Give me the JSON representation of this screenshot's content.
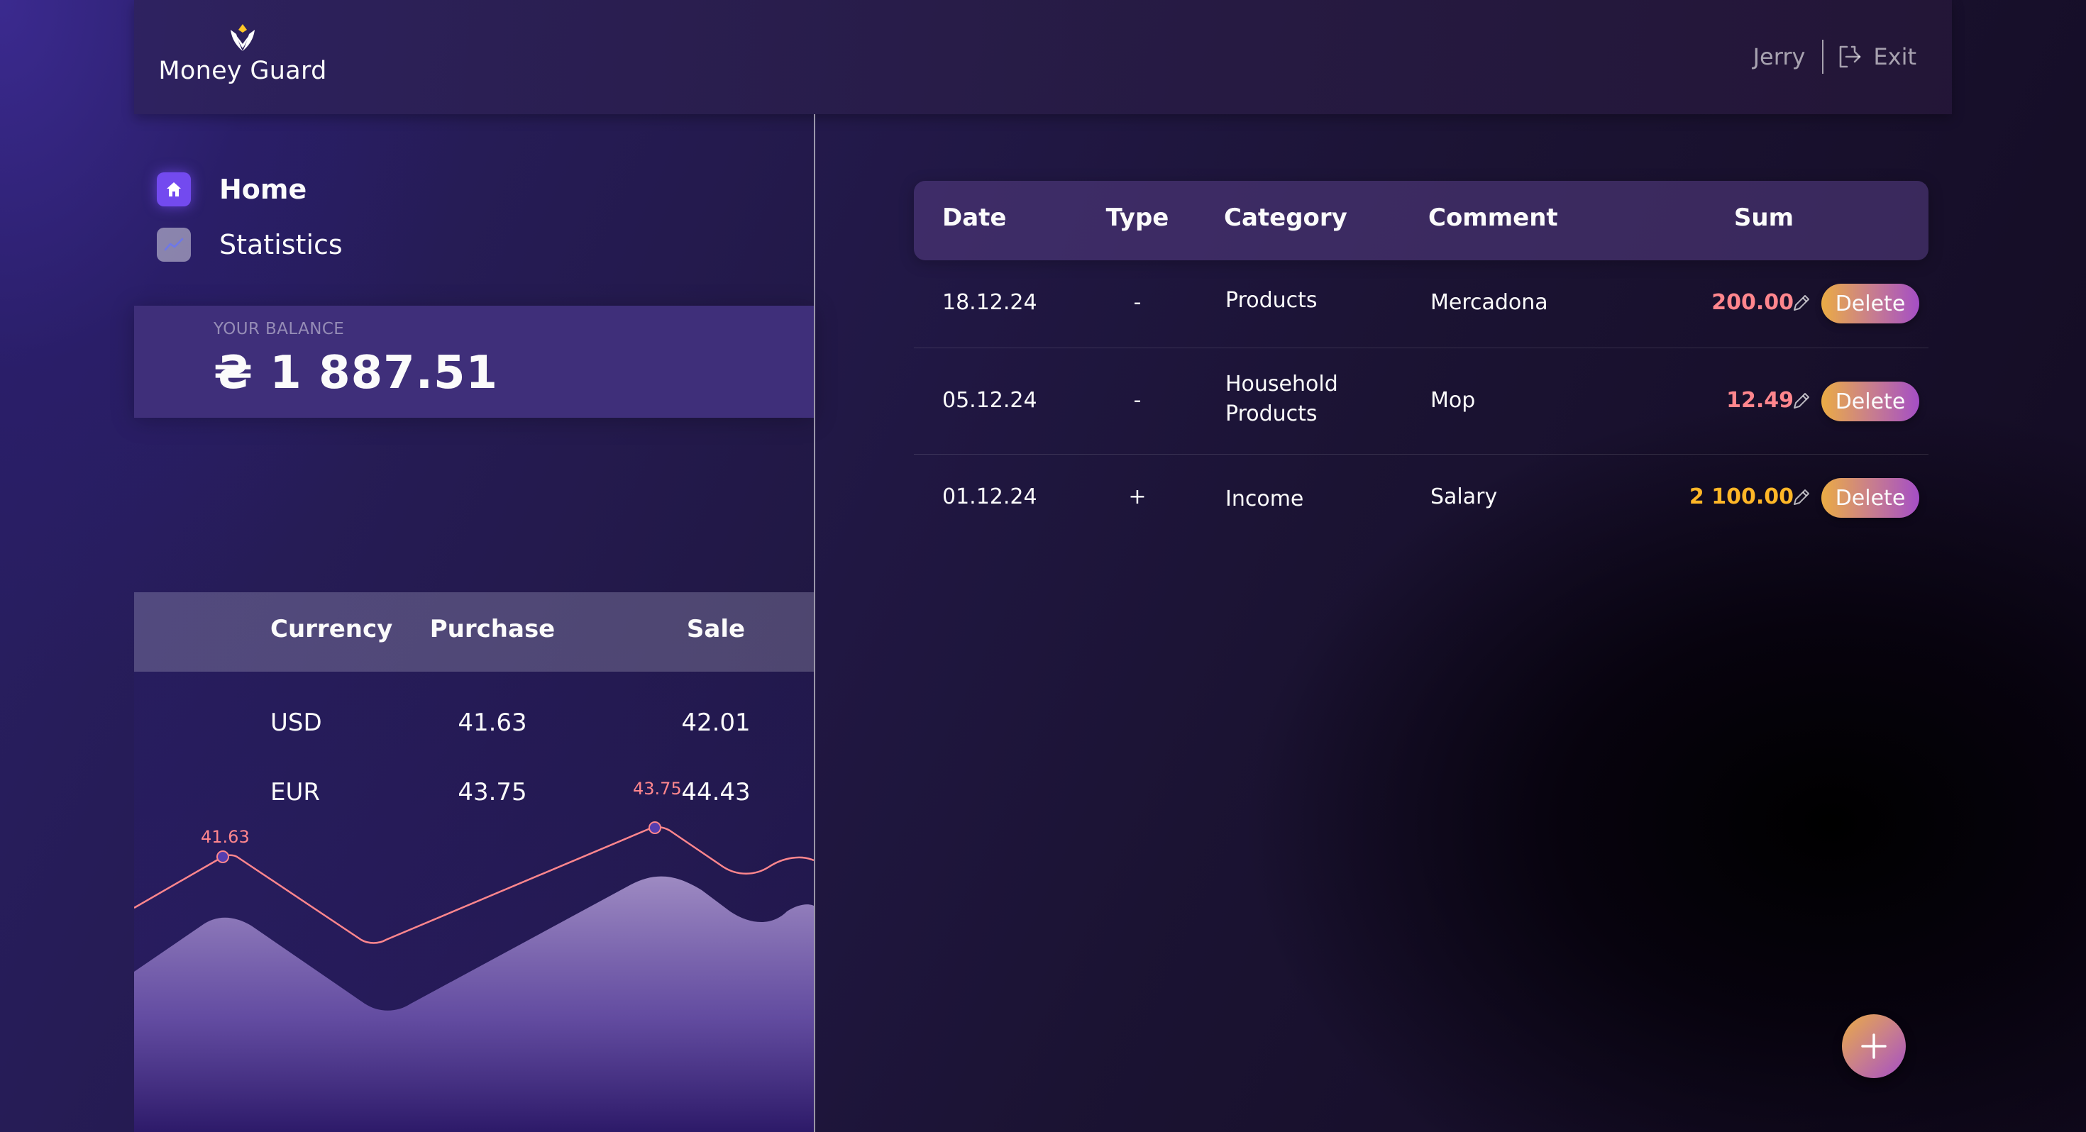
{
  "header": {
    "app_name": "Money Guard",
    "user_name": "Jerry",
    "exit_label": "Exit"
  },
  "sidebar": {
    "nav": [
      {
        "label": "Home",
        "icon": "home-icon",
        "active": true
      },
      {
        "label": "Statistics",
        "icon": "statistics-icon",
        "active": false
      }
    ],
    "balance": {
      "title": "Your balance",
      "value": "₴ 1 887.51"
    },
    "currency": {
      "headers": [
        "Currency",
        "Purchase",
        "Sale"
      ],
      "rows": [
        {
          "currency": "USD",
          "purchase": "41.63",
          "sale": "42.01"
        },
        {
          "currency": "EUR",
          "purchase": "43.75",
          "sale": "44.43"
        }
      ],
      "chart_labels": [
        "41.63",
        "43.75"
      ]
    }
  },
  "transactions": {
    "headers": {
      "date": "Date",
      "type": "Type",
      "category": "Category",
      "comment": "Comment",
      "sum": "Sum"
    },
    "delete_label": "Delete",
    "rows": [
      {
        "date": "18.12.24",
        "type": "-",
        "category": "Products",
        "comment": "Mercadona",
        "sum": "200.00",
        "sum_color": "#ff868d"
      },
      {
        "date": "05.12.24",
        "type": "-",
        "category": "Household Products",
        "comment": "Mop",
        "sum": "12.49",
        "sum_color": "#ff868d"
      },
      {
        "date": "01.12.24",
        "type": "+",
        "category": "Income",
        "comment": "Salary",
        "sum": "2 100.00",
        "sum_color": "#ffb627"
      }
    ]
  },
  "colors": {
    "accent": "#734aef",
    "expense": "#ff868d",
    "income": "#ffb627",
    "button_gradient_start": "#ebac44",
    "button_gradient_end": "#a44ec6"
  }
}
